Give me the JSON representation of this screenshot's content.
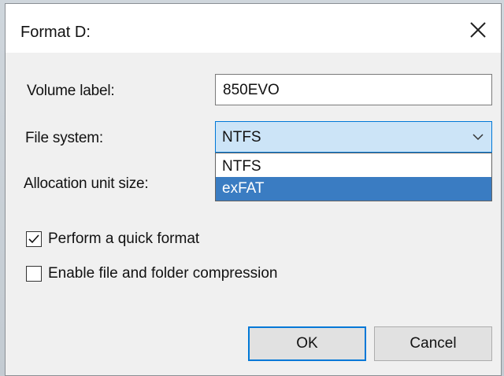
{
  "dialog": {
    "title": "Format D:",
    "close_icon": "close-icon"
  },
  "volume_label": {
    "label": "Volume label:",
    "value": "850EVO"
  },
  "file_system": {
    "label": "File system:",
    "selected": "NTFS",
    "options": [
      "NTFS",
      "exFAT"
    ],
    "highlighted_option": "exFAT"
  },
  "allocation_unit_size": {
    "label": "Allocation unit size:"
  },
  "options": {
    "quick_format": {
      "label": "Perform a quick format",
      "checked": true
    },
    "compression": {
      "label": "Enable file and folder compression",
      "checked": false
    }
  },
  "buttons": {
    "ok": "OK",
    "cancel": "Cancel"
  },
  "colors": {
    "dialog_bg": "#f0f0f0",
    "accent": "#0078d7",
    "selected_option_bg": "#3a7cc2",
    "select_bg": "#cce4f7"
  }
}
